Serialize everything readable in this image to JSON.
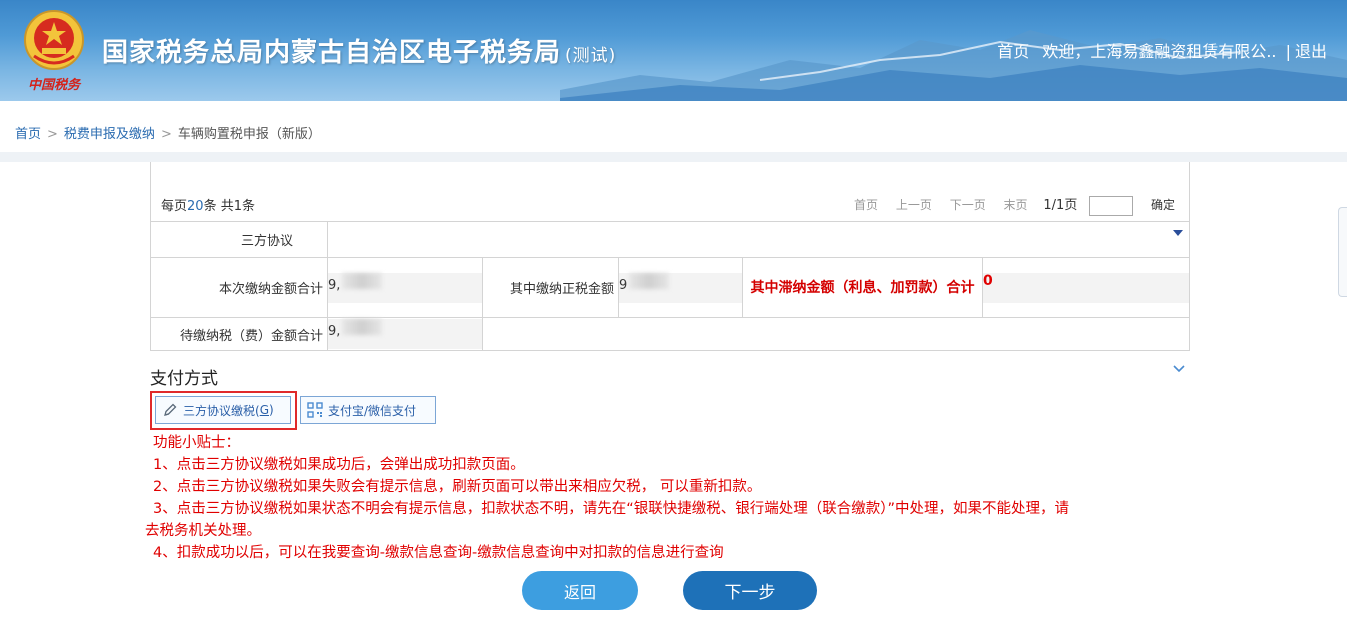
{
  "header": {
    "emblem_text": "中国税务",
    "title": "国家税务总局内蒙古自治区电子税务局",
    "title_sub": "(测试)",
    "nav_home": "首页",
    "nav_welcome": "欢迎，上海易鑫融资租赁有限公..",
    "nav_sep": "|",
    "nav_logout": "退出"
  },
  "breadcrumb": {
    "home": "首页",
    "level1": "税费申报及缴纳",
    "current": "车辆购置税申报（新版）",
    "sep": ">"
  },
  "pager": {
    "per_page_prefix": "每页",
    "per_page_value": "20",
    "per_page_suffix": "条 共1条",
    "first": "首页",
    "prev": "上一页",
    "next": "下一页",
    "last": "末页",
    "page_info": "1/1页",
    "go": "确定"
  },
  "table": {
    "three_party_label": "三方协议",
    "three_party_value": "",
    "total_paid_label": "本次缴纳金额合计",
    "total_paid_value": "9,",
    "tax_paid_label": "其中缴纳正税金额",
    "tax_paid_value": "9",
    "late_fee_label": "其中滞纳金额（利息、加罚款）合计",
    "late_fee_value": "0",
    "pending_label": "待缴纳税（费）金额合计",
    "pending_value": "9,"
  },
  "payment": {
    "title": "支付方式",
    "btn_third_party": "三方协议缴税(",
    "btn_third_party_key": "G",
    "btn_third_party_end": ")",
    "btn_alipay": "支付宝/微信支付"
  },
  "tips": {
    "title": "功能小贴士：",
    "items": [
      "1、点击三方协议缴税如果成功后，会弹出成功扣款页面。",
      "2、点击三方协议缴税如果失败会有提示信息，刷新页面可以带出来相应欠税， 可以重新扣款。",
      "3、点击三方协议缴税如果状态不明会有提示信息，扣款状态不明，请先在“银联快捷缴税、银行端处理（联合缴款）”中处理，如果不能处理，请",
      "去税务机关处理。",
      "4、扣款成功以后，可以在我要查询-缴款信息查询-缴款信息查询中对扣款的信息进行查询"
    ]
  },
  "actions": {
    "back": "返回",
    "next": "下一步"
  },
  "colors": {
    "header_blue": "#3a86c8",
    "link_blue": "#2a6bb0",
    "tip_red": "#e00000",
    "btn_back": "#3d9ee0",
    "btn_next": "#1e71b8"
  }
}
